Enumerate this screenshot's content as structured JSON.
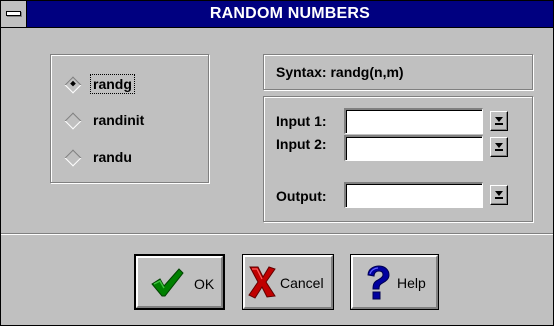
{
  "window": {
    "title": "RANDOM NUMBERS"
  },
  "functions": {
    "items": [
      {
        "label": "randg",
        "checked": true
      },
      {
        "label": "randinit",
        "checked": false
      },
      {
        "label": "randu",
        "checked": false
      }
    ]
  },
  "syntax": {
    "text": "Syntax:  randg(n,m)"
  },
  "io": {
    "input1_label": "Input 1:",
    "input1_value": "",
    "input2_label": "Input 2:",
    "input2_value": "",
    "output_label": "Output:",
    "output_value": ""
  },
  "buttons": {
    "ok_label": "OK",
    "cancel_label": "Cancel",
    "help_label": "Help"
  },
  "icons": {
    "ok": "check-icon",
    "cancel": "x-icon",
    "help": "question-icon",
    "dropdown": "down-arrow-icon"
  },
  "colors": {
    "titlebar": "#000080",
    "face": "#c0c0c0",
    "check_green": "#008000",
    "cancel_red": "#c00000",
    "help_blue": "#0000a0"
  }
}
